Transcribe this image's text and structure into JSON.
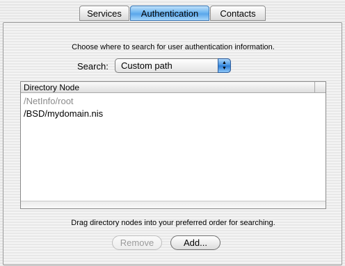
{
  "tabs": [
    {
      "label": "Services",
      "active": false
    },
    {
      "label": "Authentication",
      "active": true
    },
    {
      "label": "Contacts",
      "active": false
    }
  ],
  "panel": {
    "instruction_top": "Choose where to search for user authentication information.",
    "search": {
      "label": "Search:",
      "selected": "Custom path",
      "icon": "up-down-arrows-icon"
    },
    "table": {
      "column_header": "Directory Node",
      "rows": [
        {
          "label": "/NetInfo/root",
          "disabled": true
        },
        {
          "label": "/BSD/mydomain.nis",
          "disabled": false
        }
      ]
    },
    "instruction_bottom": "Drag directory nodes into your preferred order for searching.",
    "buttons": {
      "remove": "Remove",
      "add": "Add..."
    }
  },
  "colors": {
    "active_tab": "#5aa6ea",
    "disabled_text": "#8a8a8a"
  }
}
